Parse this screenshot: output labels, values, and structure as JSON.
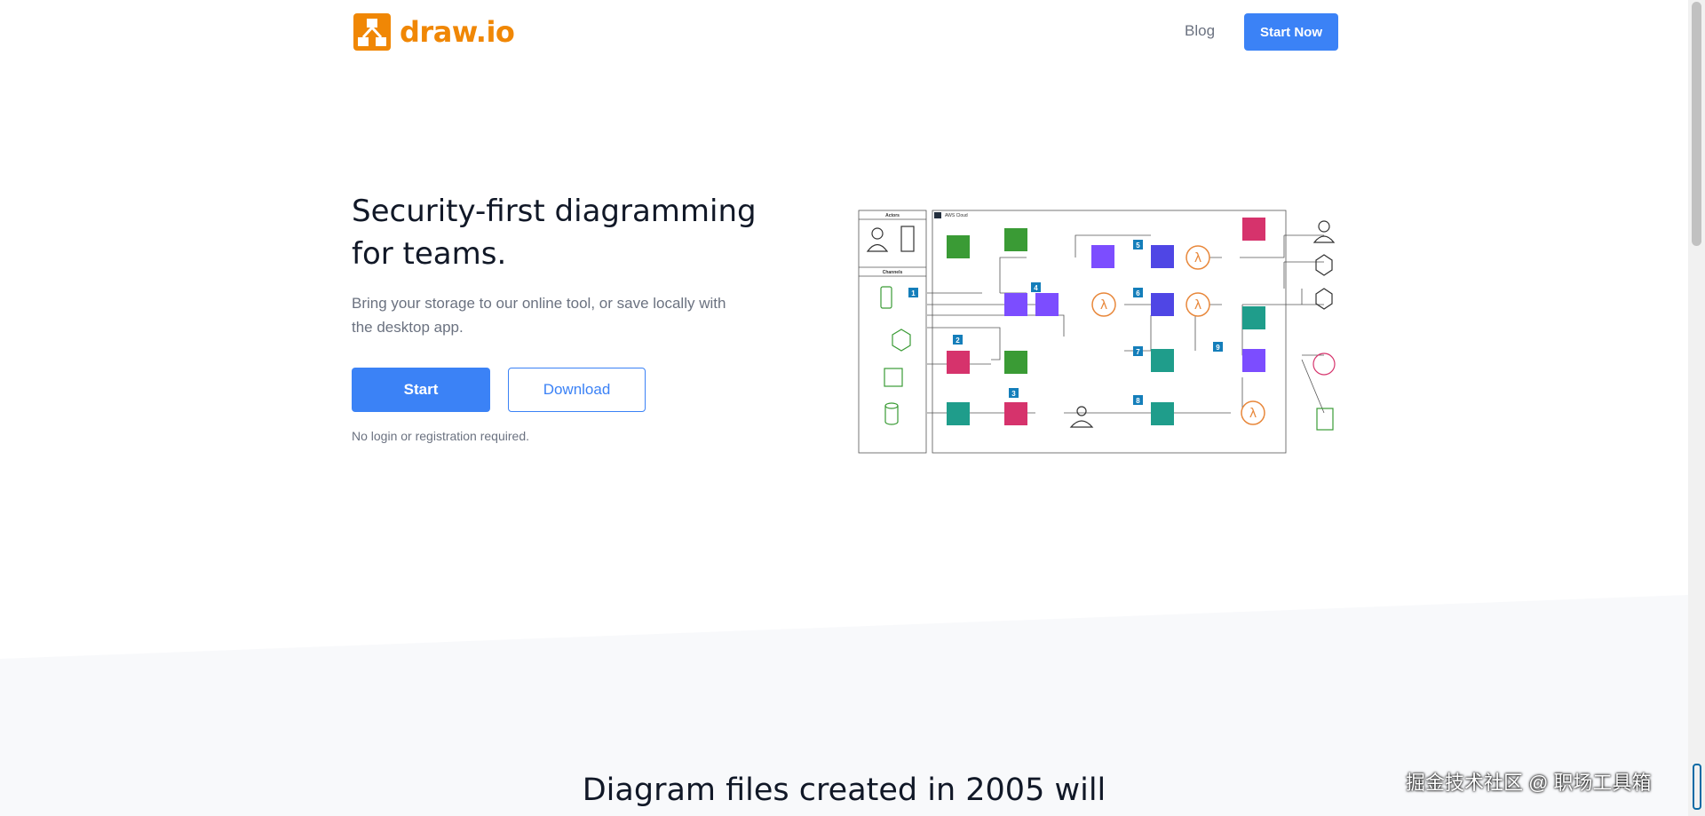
{
  "brand": {
    "name": "draw.io",
    "color": "#f08705",
    "accent": "#3b82f6"
  },
  "nav": {
    "blog": "Blog",
    "start_now": "Start Now"
  },
  "hero": {
    "title_line1": "Security-first diagramming",
    "title_line2": "for teams.",
    "subtitle_line1": "Bring your storage to our online tool, or save locally with",
    "subtitle_line2": "the desktop app.",
    "primary_button": "Start",
    "secondary_button": "Download",
    "note": "No login or registration required."
  },
  "diagram": {
    "groups": {
      "actors": "Actors",
      "channels": "Channels",
      "cloud": "AWS Cloud"
    },
    "step_badges": [
      "1",
      "2",
      "3",
      "4",
      "5",
      "6",
      "7",
      "8",
      "9"
    ],
    "icons": [
      "user-icon",
      "building-icon",
      "mobile-icon",
      "cube-icon",
      "chip-icon",
      "database-icon",
      "lambda-icon",
      "bucket-icon",
      "target-icon",
      "users-icon",
      "document-icon",
      "globe-icon"
    ],
    "colors": {
      "pink": "#d6336c",
      "purple": "#7c4dff",
      "green": "#3a9b35",
      "orange": "#e8873a",
      "teal": "#1f9d8b",
      "badge": "#147eba"
    }
  },
  "section": {
    "heading": "Diagram files created in 2005 will"
  },
  "watermark": "掘金技术社区 @ 职场工具箱"
}
